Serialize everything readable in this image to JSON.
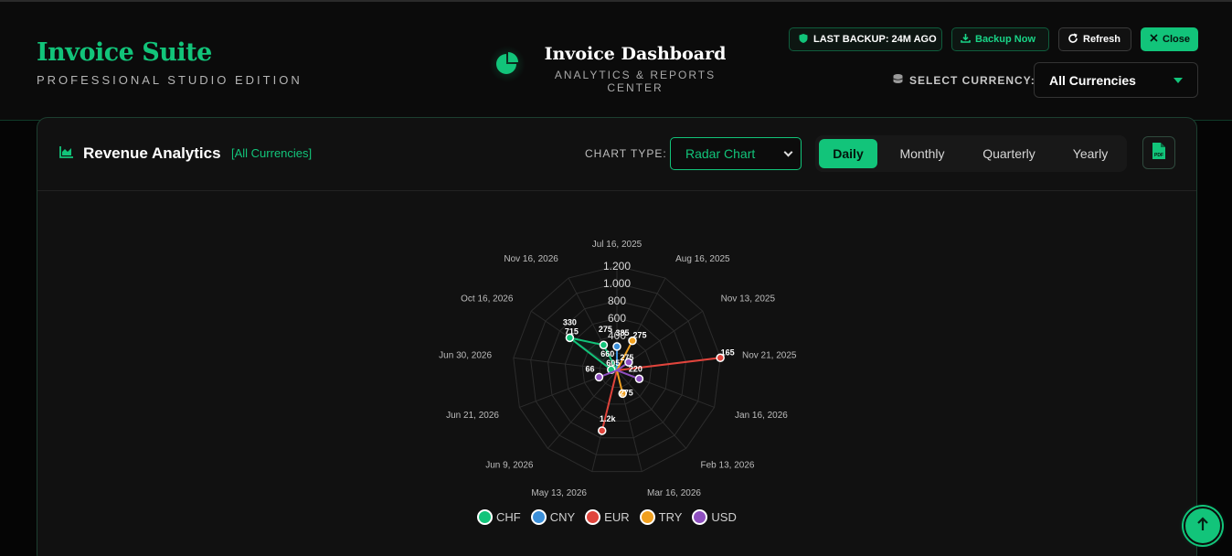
{
  "header": {
    "brand_title": "Invoice Suite",
    "brand_subtitle": "PROFESSIONAL STUDIO EDITION",
    "dashboard_title": "Invoice Dashboard",
    "dashboard_subtitle": "ANALYTICS & REPORTS CENTER",
    "backup_status": "LAST BACKUP: 24M AGO",
    "backup_now_label": "Backup Now",
    "refresh_label": "Refresh",
    "close_label": "Close",
    "currency_label": "SELECT CURRENCY:",
    "currency_value": "All Currencies"
  },
  "panel": {
    "title": "Revenue Analytics",
    "currency_tag": "[All Currencies]",
    "chart_type_label": "CHART TYPE:",
    "chart_type_value": "Radar Chart",
    "periods": [
      "Daily",
      "Monthly",
      "Quarterly",
      "Yearly"
    ],
    "active_period": "Daily",
    "pdf_label": "PDF"
  },
  "colors": {
    "accent": "#12c47a",
    "CHF": "#12c47a",
    "CNY": "#3b8fd9",
    "EUR": "#e0443c",
    "TRY": "#f0a020",
    "USD": "#8e4fbf"
  },
  "chart_data": {
    "type": "radar",
    "categories": [
      "Jul 16, 2025",
      "Aug 16, 2025",
      "Nov 13, 2025",
      "Nov 21, 2025",
      "Jan 16, 2026",
      "Feb 13, 2026",
      "Mar 16, 2026",
      "May 13, 2026",
      "Jun 9, 2026",
      "Jun 21, 2026",
      "Jun 30, 2026",
      "Oct 16, 2026",
      "Nov 16, 2026"
    ],
    "r_ticks": [
      "1.200",
      "1.000",
      "800",
      "600",
      "400"
    ],
    "rlim": [
      0,
      1200
    ],
    "legend_position": "bottom",
    "series": [
      {
        "name": "CHF",
        "values": [
          0,
          0,
          0,
          0,
          0,
          0,
          0,
          0,
          0,
          0,
          66,
          660,
          330
        ]
      },
      {
        "name": "CNY",
        "values": [
          275,
          0,
          0,
          0,
          0,
          0,
          0,
          0,
          0,
          0,
          0,
          0,
          0
        ]
      },
      {
        "name": "EUR",
        "values": [
          0,
          0,
          0,
          1200,
          0,
          0,
          0,
          715,
          0,
          0,
          0,
          0,
          0
        ]
      },
      {
        "name": "TRY",
        "values": [
          0,
          385,
          0,
          0,
          0,
          0,
          275,
          0,
          0,
          0,
          0,
          0,
          0
        ]
      },
      {
        "name": "USD",
        "values": [
          0,
          0,
          165,
          0,
          275,
          0,
          0,
          0,
          0,
          220,
          0,
          0,
          0
        ]
      }
    ],
    "data_labels": [
      "660",
      "330",
      "275",
      "385",
      "165",
      "1.2k",
      "275",
      "275",
      "275",
      "220",
      "66",
      "605",
      "715"
    ]
  }
}
